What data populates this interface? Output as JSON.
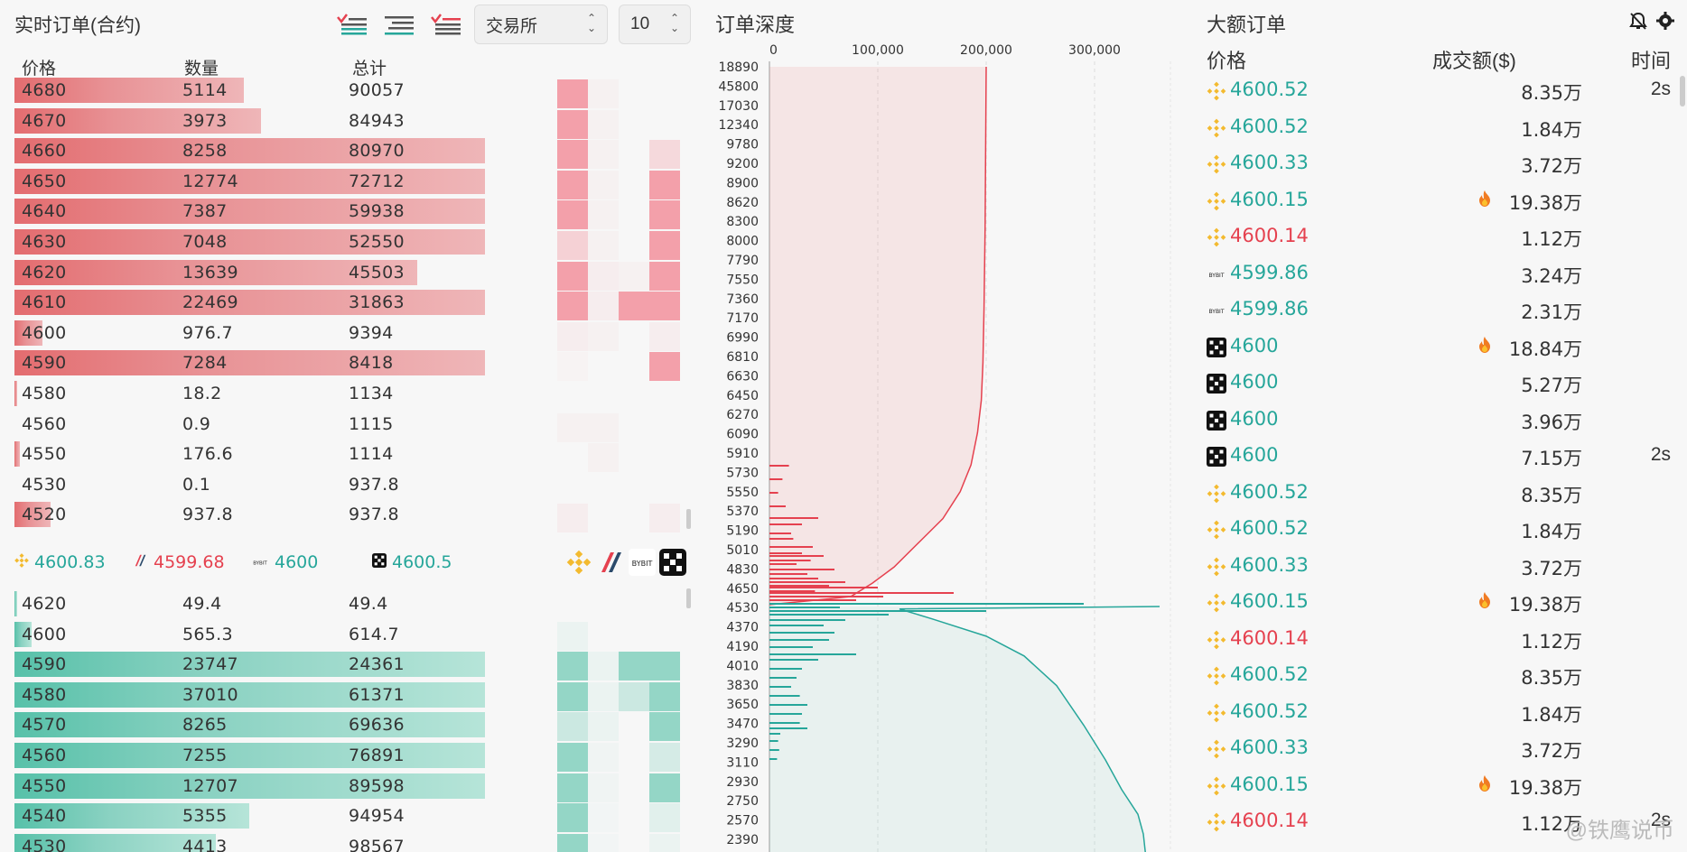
{
  "orderbook": {
    "title": "实时订单(合约)",
    "exchange_select": "交易所",
    "depth_select": "10",
    "columns": [
      "价格",
      "数量",
      "总计"
    ],
    "asks": [
      {
        "price": "4680",
        "qty": "5114",
        "total": "90057",
        "fill": 0.41
      },
      {
        "price": "4670",
        "qty": "3973",
        "total": "84943",
        "fill": 0.44
      },
      {
        "price": "4660",
        "qty": "8258",
        "total": "80970",
        "fill": 0.84
      },
      {
        "price": "4650",
        "qty": "12774",
        "total": "72712",
        "fill": 0.84
      },
      {
        "price": "4640",
        "qty": "7387",
        "total": "59938",
        "fill": 0.84
      },
      {
        "price": "4630",
        "qty": "7048",
        "total": "52550",
        "fill": 0.84
      },
      {
        "price": "4620",
        "qty": "13639",
        "total": "45503",
        "fill": 0.72
      },
      {
        "price": "4610",
        "qty": "22469",
        "total": "31863",
        "fill": 0.84
      },
      {
        "price": "4600",
        "qty": "976.7",
        "total": "9394",
        "fill": 0.05
      },
      {
        "price": "4590",
        "qty": "7284",
        "total": "8418",
        "fill": 0.84
      },
      {
        "price": "4580",
        "qty": "18.2",
        "total": "1134",
        "fill": 0.003
      },
      {
        "price": "4560",
        "qty": "0.9",
        "total": "1115",
        "fill": 0.0
      },
      {
        "price": "4550",
        "qty": "176.6",
        "total": "1114",
        "fill": 0.01
      },
      {
        "price": "4530",
        "qty": "0.1",
        "total": "937.8",
        "fill": 0.0
      },
      {
        "price": "4520",
        "qty": "937.8",
        "total": "937.8",
        "fill": 0.065
      }
    ],
    "bids": [
      {
        "price": "4620",
        "qty": "49.4",
        "total": "49.4",
        "fill": 0.004
      },
      {
        "price": "4600",
        "qty": "565.3",
        "total": "614.7",
        "fill": 0.03
      },
      {
        "price": "4590",
        "qty": "23747",
        "total": "24361",
        "fill": 0.84
      },
      {
        "price": "4580",
        "qty": "37010",
        "total": "61371",
        "fill": 0.84
      },
      {
        "price": "4570",
        "qty": "8265",
        "total": "69636",
        "fill": 0.84
      },
      {
        "price": "4560",
        "qty": "7255",
        "total": "76891",
        "fill": 0.84
      },
      {
        "price": "4550",
        "qty": "12707",
        "total": "89598",
        "fill": 0.84
      },
      {
        "price": "4540",
        "qty": "5355",
        "total": "94954",
        "fill": 0.42
      },
      {
        "price": "4530",
        "qty": "4413",
        "total": "98567",
        "fill": 0.36
      }
    ],
    "exchange_prices": [
      {
        "exchange": "binance",
        "price": "4600.83",
        "color": "#26a69a"
      },
      {
        "exchange": "huobi",
        "price": "4599.68",
        "color": "#e5414f"
      },
      {
        "exchange": "bybit",
        "price": "4600",
        "color": "#26a69a"
      },
      {
        "exchange": "okx",
        "price": "4600.5",
        "color": "#26a69a"
      }
    ]
  },
  "depth": {
    "title": "订单深度",
    "x_ticks": [
      "0",
      "100,000",
      "200,000",
      "300,000"
    ],
    "y_labels": [
      "18890",
      "45800",
      "17030",
      "12340",
      "9780",
      "9200",
      "8900",
      "8620",
      "8300",
      "8000",
      "7790",
      "7550",
      "7360",
      "7170",
      "6990",
      "6810",
      "6630",
      "6450",
      "6270",
      "6090",
      "5910",
      "5730",
      "5550",
      "5370",
      "5190",
      "5010",
      "4830",
      "4650",
      "4530",
      "4370",
      "4190",
      "4010",
      "3830",
      "3650",
      "3470",
      "3290",
      "3110",
      "2930",
      "2750",
      "2570",
      "2390"
    ]
  },
  "big_orders": {
    "title": "大额订单",
    "columns": {
      "price": "价格",
      "amount": "成交额($)",
      "time": "时间"
    },
    "rows": [
      {
        "ex": "binance",
        "price": "4600.52",
        "side": "buy",
        "amount": "8.35万",
        "hot": false,
        "time": "2s"
      },
      {
        "ex": "binance",
        "price": "4600.52",
        "side": "buy",
        "amount": "1.84万",
        "hot": false,
        "time": ""
      },
      {
        "ex": "binance",
        "price": "4600.33",
        "side": "buy",
        "amount": "3.72万",
        "hot": false,
        "time": ""
      },
      {
        "ex": "binance",
        "price": "4600.15",
        "side": "buy",
        "amount": "19.38万",
        "hot": true,
        "time": ""
      },
      {
        "ex": "binance",
        "price": "4600.14",
        "side": "sell",
        "amount": "1.12万",
        "hot": false,
        "time": ""
      },
      {
        "ex": "bybit",
        "price": "4599.86",
        "side": "buy",
        "amount": "3.24万",
        "hot": false,
        "time": ""
      },
      {
        "ex": "bybit",
        "price": "4599.86",
        "side": "buy",
        "amount": "2.31万",
        "hot": false,
        "time": ""
      },
      {
        "ex": "okx",
        "price": "4600",
        "side": "buy",
        "amount": "18.84万",
        "hot": true,
        "time": ""
      },
      {
        "ex": "okx",
        "price": "4600",
        "side": "buy",
        "amount": "5.27万",
        "hot": false,
        "time": ""
      },
      {
        "ex": "okx",
        "price": "4600",
        "side": "buy",
        "amount": "3.96万",
        "hot": false,
        "time": ""
      },
      {
        "ex": "okx",
        "price": "4600",
        "side": "buy",
        "amount": "7.15万",
        "hot": false,
        "time": "2s"
      },
      {
        "ex": "binance",
        "price": "4600.52",
        "side": "buy",
        "amount": "8.35万",
        "hot": false,
        "time": ""
      },
      {
        "ex": "binance",
        "price": "4600.52",
        "side": "buy",
        "amount": "1.84万",
        "hot": false,
        "time": ""
      },
      {
        "ex": "binance",
        "price": "4600.33",
        "side": "buy",
        "amount": "3.72万",
        "hot": false,
        "time": ""
      },
      {
        "ex": "binance",
        "price": "4600.15",
        "side": "buy",
        "amount": "19.38万",
        "hot": true,
        "time": ""
      },
      {
        "ex": "binance",
        "price": "4600.14",
        "side": "sell",
        "amount": "1.12万",
        "hot": false,
        "time": ""
      },
      {
        "ex": "binance",
        "price": "4600.52",
        "side": "buy",
        "amount": "8.35万",
        "hot": false,
        "time": ""
      },
      {
        "ex": "binance",
        "price": "4600.52",
        "side": "buy",
        "amount": "1.84万",
        "hot": false,
        "time": ""
      },
      {
        "ex": "binance",
        "price": "4600.33",
        "side": "buy",
        "amount": "3.72万",
        "hot": false,
        "time": ""
      },
      {
        "ex": "binance",
        "price": "4600.15",
        "side": "buy",
        "amount": "19.38万",
        "hot": true,
        "time": ""
      },
      {
        "ex": "binance",
        "price": "4600.14",
        "side": "sell",
        "amount": "1.12万",
        "hot": false,
        "time": "2s"
      }
    ]
  },
  "watermark": "@铁鹰说币",
  "colors": {
    "ask": "#e5414f",
    "bid": "#26a69a",
    "binance": "#f3ba2f"
  }
}
